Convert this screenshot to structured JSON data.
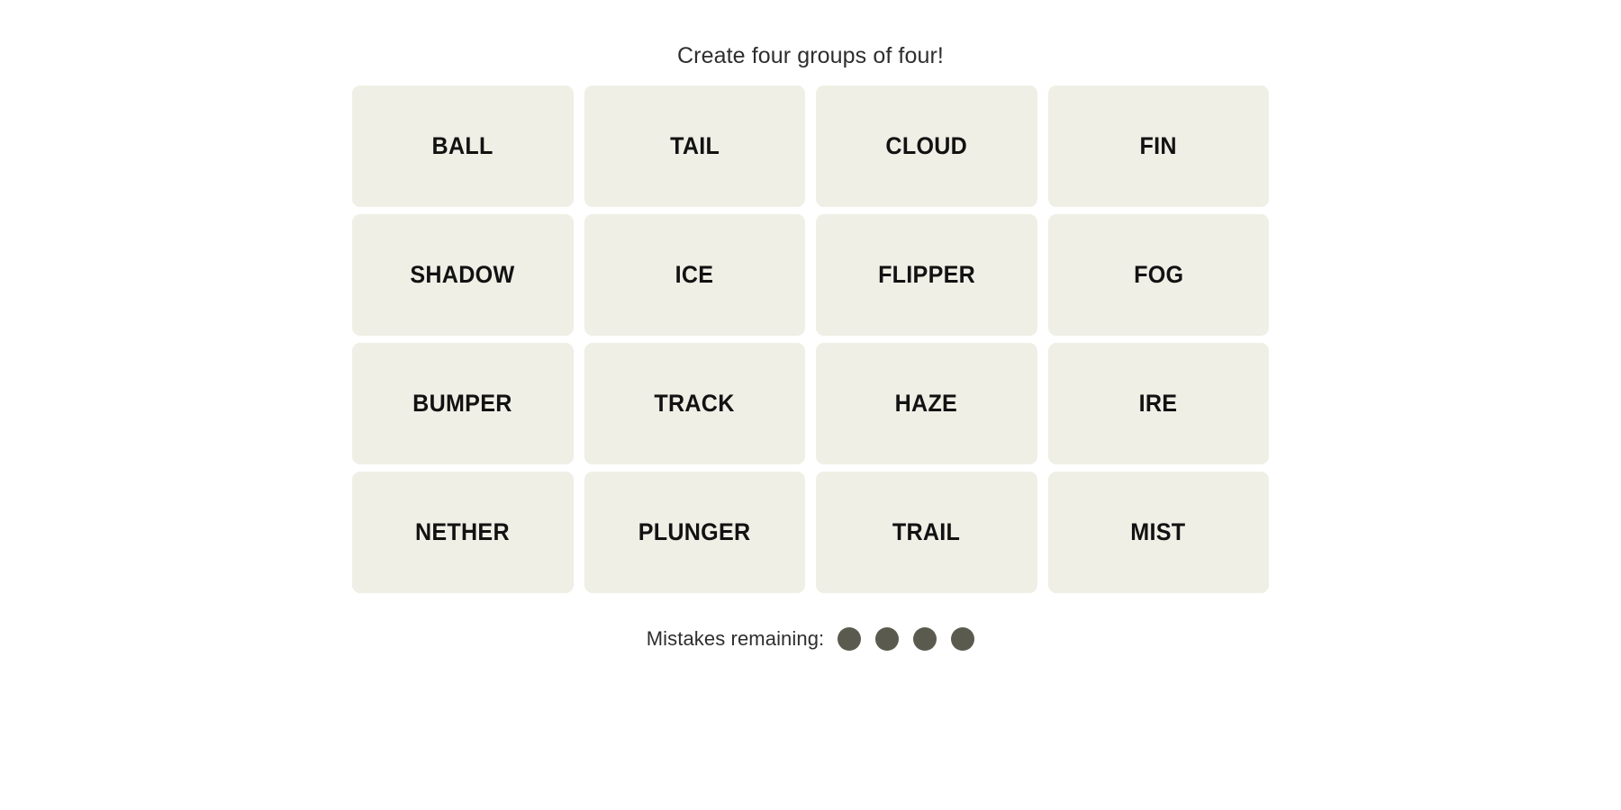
{
  "header": {
    "instruction": "Create four groups of four!"
  },
  "board": {
    "columns": 4,
    "rows": 4,
    "tile_color": "#EFEFE6",
    "tile_text_color": "#121212",
    "tiles": [
      {
        "label": "BALL",
        "row": 1,
        "col": 1,
        "selected": false
      },
      {
        "label": "TAIL",
        "row": 1,
        "col": 2,
        "selected": false
      },
      {
        "label": "CLOUD",
        "row": 1,
        "col": 3,
        "selected": false
      },
      {
        "label": "FIN",
        "row": 1,
        "col": 4,
        "selected": false
      },
      {
        "label": "SHADOW",
        "row": 2,
        "col": 1,
        "selected": false
      },
      {
        "label": "ICE",
        "row": 2,
        "col": 2,
        "selected": false
      },
      {
        "label": "FLIPPER",
        "row": 2,
        "col": 3,
        "selected": false
      },
      {
        "label": "FOG",
        "row": 2,
        "col": 4,
        "selected": false
      },
      {
        "label": "BUMPER",
        "row": 3,
        "col": 1,
        "selected": false
      },
      {
        "label": "TRACK",
        "row": 3,
        "col": 2,
        "selected": false
      },
      {
        "label": "HAZE",
        "row": 3,
        "col": 3,
        "selected": false
      },
      {
        "label": "IRE",
        "row": 3,
        "col": 4,
        "selected": false
      },
      {
        "label": "NETHER",
        "row": 4,
        "col": 1,
        "selected": false
      },
      {
        "label": "PLUNGER",
        "row": 4,
        "col": 2,
        "selected": false
      },
      {
        "label": "TRAIL",
        "row": 4,
        "col": 3,
        "selected": false
      },
      {
        "label": "MIST",
        "row": 4,
        "col": 4,
        "selected": false
      }
    ]
  },
  "footer": {
    "mistakes_label": "Mistakes remaining:",
    "mistakes_remaining": 4,
    "dot_color": "#5A5A4E"
  }
}
